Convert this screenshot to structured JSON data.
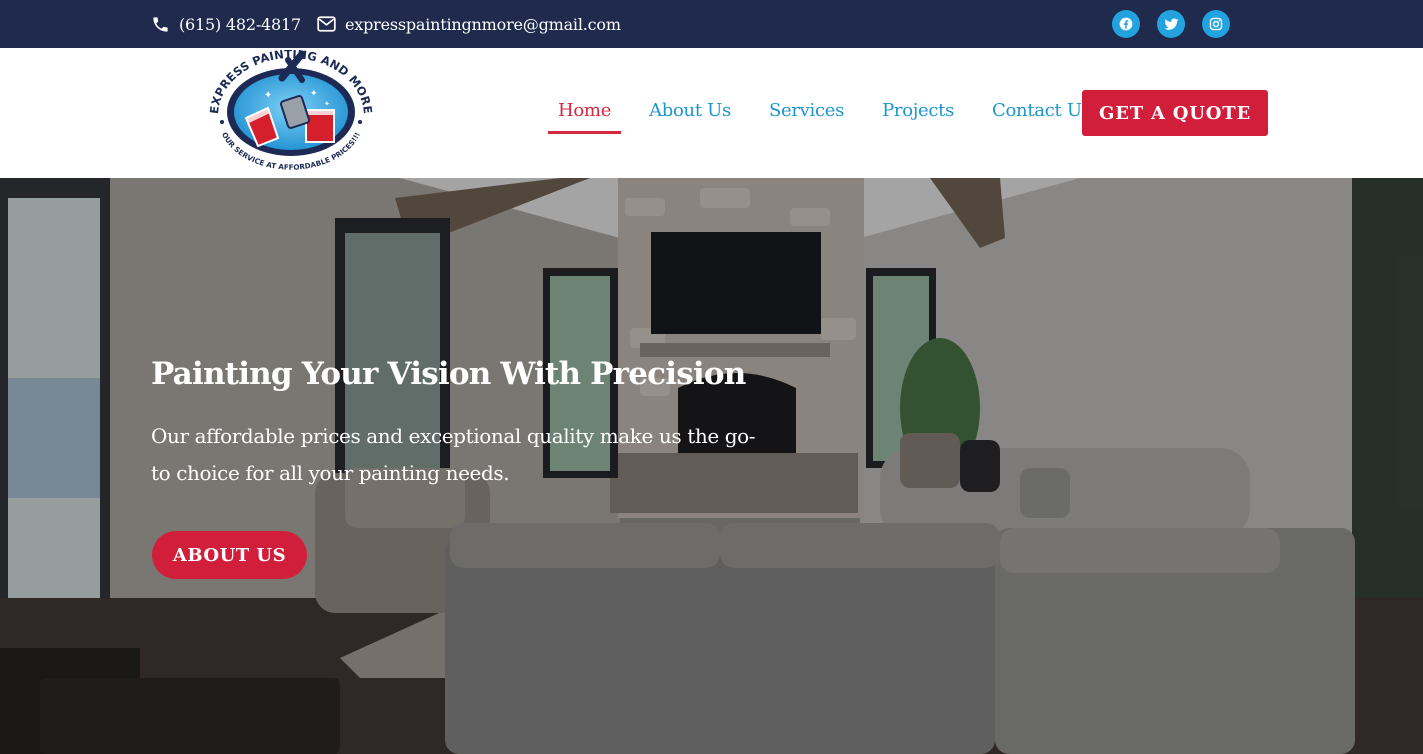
{
  "topbar": {
    "phone": "(615) 482-4817",
    "email": "expresspaintingnmore@gmail.com",
    "phone_icon": "phone-icon",
    "email_icon": "envelope-icon",
    "socials": [
      "facebook-icon",
      "twitter-icon",
      "instagram-icon"
    ],
    "background": "#1f2a4d",
    "social_color": "#22a3df"
  },
  "logo": {
    "top_text": "EXPRESS PAINTING AND MORE",
    "bottom_text": "OUR SERVICE AT AFFORDABLE PRICES!!!"
  },
  "nav": {
    "items": [
      {
        "label": "Home",
        "active": true
      },
      {
        "label": "About Us",
        "active": false
      },
      {
        "label": "Services",
        "active": false
      },
      {
        "label": "Projects",
        "active": false
      },
      {
        "label": "Contact Us",
        "active": false
      }
    ],
    "quote_label": "GET A QUOTE",
    "link_color": "#1c96cf",
    "accent": "#d42a3d"
  },
  "hero": {
    "title": "Painting Your Vision With Precision",
    "subtitle": "Our affordable prices and exceptional quality make us the go-to choice for all your painting needs.",
    "button_label": "ABOUT US"
  }
}
